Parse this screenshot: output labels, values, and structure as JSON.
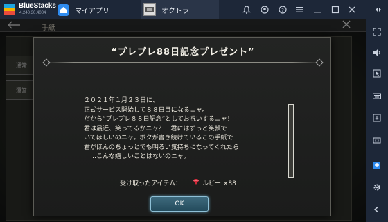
{
  "app": {
    "name": "BlueStacks",
    "version": "4.240.30.4004"
  },
  "tabs": [
    {
      "label": "マイアプリ",
      "icon": "home-icon"
    },
    {
      "label": "オクトラ",
      "icon": "game-icon"
    }
  ],
  "toolbar_icons": [
    "notification-bell-icon",
    "account-icon",
    "help-icon",
    "menu-icon",
    "minimize-icon",
    "maximize-icon",
    "close-icon",
    "expand-icon"
  ],
  "sidebar_icons": [
    "fullscreen-icon",
    "volume-icon",
    "pointer-icon",
    "keyboard-icon",
    "install-apk-icon",
    "screenshot-icon",
    "multi-instance-icon",
    "settings-icon",
    "back-icon"
  ],
  "game": {
    "header_title": "手紙",
    "side_tabs": [
      "通常",
      "運営"
    ],
    "modal": {
      "title": "“プレプレ88日記念プレゼント”",
      "body_lines": [
        "２０２１年１月２３日に、",
        "正式サービス開始して８８日目になるニャ。",
        "だから”プレプレ８８日記念”としてお祝いするニャ！",
        "君は最近、笑ってるかニャ？　君にはずっと笑顔で",
        "いてほしいのニャ。ボクが書き続けているこの手紙で",
        "君がほんのちょっとでも明るい気持ちになってくれたら",
        "……こんな嬉しいことはないのニャ。"
      ],
      "items_label": "受け取ったアイテム：",
      "item_name": "ルビー ×88",
      "ok_label": "OK"
    }
  },
  "colors": {
    "topbar": "#1d2738",
    "ok_button": "#2f5a6c",
    "gem": "#d22a3a"
  }
}
